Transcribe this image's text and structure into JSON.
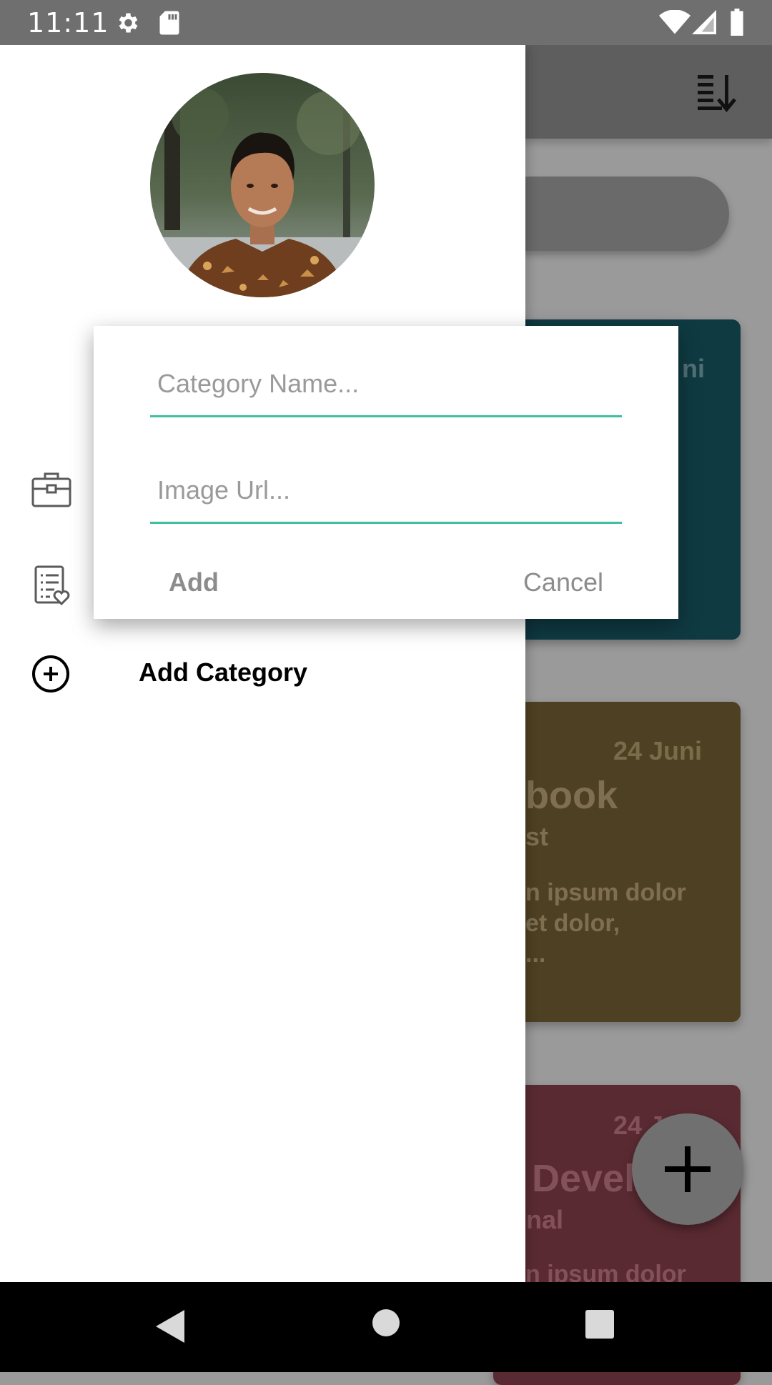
{
  "status_bar": {
    "time": "11:11",
    "icons": [
      "settings-icon",
      "sd-card-icon",
      "wifi-icon",
      "signal-icon",
      "battery-icon"
    ]
  },
  "app_bar": {
    "sort_icon": "sort-descending-icon"
  },
  "cards": [
    {
      "date": "ni",
      "color": "#0f3a42"
    },
    {
      "date": "24 Juni",
      "title": "book",
      "subtitle": "st",
      "body": [
        "n ipsum dolor",
        "et dolor,",
        "..."
      ],
      "color": "#4e4022"
    },
    {
      "date": "24 Juni",
      "title": "Devel",
      "subtitle": "nal",
      "body": [
        "n ipsum dolor"
      ],
      "color": "#5a2a32"
    }
  ],
  "drawer": {
    "avatar_alt": "profile photo",
    "menu": [
      {
        "icon": "briefcase-icon"
      },
      {
        "icon": "favorite-list-icon"
      },
      {
        "icon": "add-circle-icon",
        "label": "Add Category"
      }
    ]
  },
  "dialog": {
    "category_name_placeholder": "Category Name...",
    "category_name_value": "",
    "image_url_placeholder": "Image Url...",
    "image_url_value": "",
    "add_label": "Add",
    "cancel_label": "Cancel",
    "accent": "#3dc0a0"
  },
  "fab": {
    "icon": "plus-icon"
  },
  "nav_bar": {
    "icons": [
      "back-icon",
      "home-icon",
      "recents-icon"
    ]
  }
}
